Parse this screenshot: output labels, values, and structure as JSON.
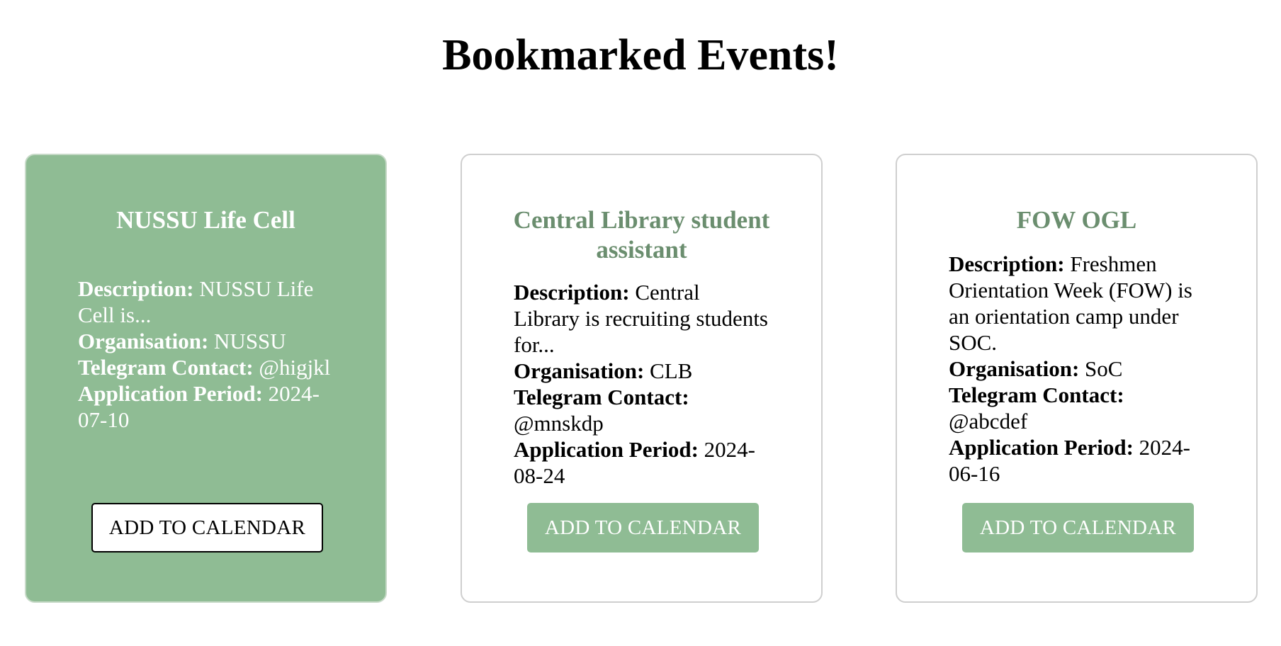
{
  "page": {
    "title": "Bookmarked Events!"
  },
  "labels": {
    "description": "Description:",
    "organisation": "Organisation:",
    "telegram": "Telegram Contact:",
    "period": "Application Period:",
    "button": "ADD TO CALENDAR"
  },
  "colors": {
    "accent": "#8fbc94",
    "title_green": "#6b8e6f",
    "card_border": "#cfcfcf"
  },
  "events": [
    {
      "title": "NUSSU Life Cell",
      "description": "NUSSU Life Cell is...",
      "organisation": "NUSSU",
      "telegram": "@higjkl",
      "period": "2024-07-10",
      "highlighted": true
    },
    {
      "title": "Central Library student assistant",
      "description": "Central Library is recruiting students for...",
      "organisation": "CLB",
      "telegram": "@mnskdp",
      "period": "2024-08-24",
      "highlighted": false
    },
    {
      "title": "FOW OGL",
      "description": "Freshmen Orientation Week (FOW) is an orientation camp under SOC.",
      "organisation": "SoC",
      "telegram": "@abcdef",
      "period": "2024-06-16",
      "highlighted": false
    }
  ]
}
